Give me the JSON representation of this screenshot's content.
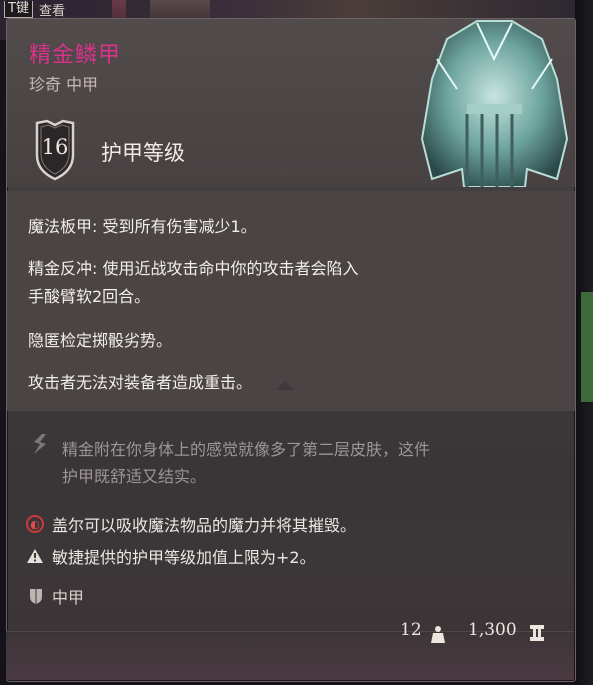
{
  "header": {
    "key_label": "T键",
    "key_action": "查看"
  },
  "item": {
    "name": "精金鳞甲",
    "rarity_type": "珍奇 中甲",
    "armor_class": "16",
    "armor_class_label": "护甲等级"
  },
  "properties": [
    {
      "label": "魔法板甲:",
      "text": "受到所有伤害减少1。"
    },
    {
      "label": "精金反冲:",
      "text": "使用近战攻击命中你的攻击者会陷入",
      "text2": "手酸臂软2回合。"
    },
    {
      "label": "",
      "text": "隐匿检定掷骰劣势。"
    },
    {
      "label": "",
      "text": "攻击者无法对装备者造成重击。"
    }
  ],
  "flavor": {
    "line1": "精金附在你身体上的感觉就像多了第二层皮肤，这件",
    "line2": "护甲既舒适又结实。"
  },
  "notes": {
    "consume": "盖尔可以吸收魔法物品的魔力并将其摧毁。",
    "dex_cap": "敏捷提供的护甲等级加值上限为+2。",
    "armor_type": "中甲"
  },
  "footer": {
    "weight": "12",
    "price": "1,300"
  },
  "colors": {
    "rarity_name": "#d8338a",
    "warning": "#c93a3a"
  },
  "icons": [
    "shield-icon",
    "armor-image",
    "flavor-quote-icon",
    "consume-icon",
    "warning-icon",
    "medium-armor-icon",
    "weight-icon",
    "gold-icon"
  ]
}
